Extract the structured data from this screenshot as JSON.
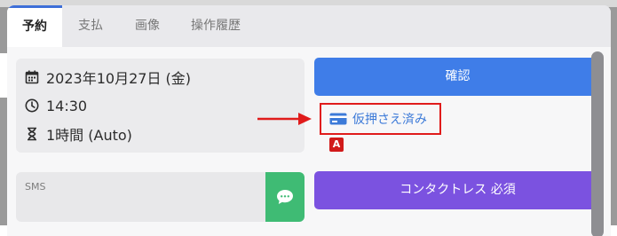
{
  "tabs": [
    {
      "label": "予約",
      "active": true
    },
    {
      "label": "支払",
      "active": false
    },
    {
      "label": "画像",
      "active": false
    },
    {
      "label": "操作履歴",
      "active": false
    }
  ],
  "info": {
    "date": "2023年10月27日 (金)",
    "time": "14:30",
    "duration": "1時間 (Auto)"
  },
  "actions": {
    "confirm_label": "確認",
    "hold_label": "仮押さえ済み",
    "contactless_label": "コンタクトレス 必須"
  },
  "sms": {
    "label": "SMS"
  },
  "annotation": {
    "badge": "A"
  },
  "colors": {
    "confirm": "#3f7de8",
    "contactless": "#7b52e0",
    "sms_button": "#3fbb74",
    "annotation_red": "#e01b1b",
    "active_tab_accent": "#3e6fd8"
  },
  "icons": [
    "calendar-icon",
    "clock-icon",
    "hourglass-icon",
    "credit-card-icon",
    "chat-bubble-icon",
    "right-arrow-icon"
  ]
}
